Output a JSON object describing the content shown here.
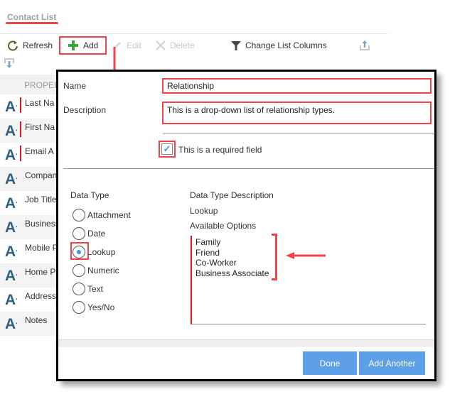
{
  "page": {
    "title": "Contact List"
  },
  "toolbar": {
    "refresh_label": "Refresh",
    "add_label": "Add",
    "edit_label": "Edit",
    "delete_label": "Delete",
    "change_columns_label": "Change List Columns",
    "icons": {
      "refresh": "refresh-icon",
      "add": "plus-icon",
      "edit": "pencil-icon",
      "delete": "x-icon",
      "change_columns": "filter-funnel-icon",
      "export": "upload-icon",
      "import": "download-icon"
    }
  },
  "list": {
    "header": "PROPER",
    "rows": [
      {
        "label": "Last Na",
        "required": true
      },
      {
        "label": "First Na",
        "required": true
      },
      {
        "label": "Email A",
        "required": true
      },
      {
        "label": "Compan",
        "required": false
      },
      {
        "label": "Job Title",
        "required": false
      },
      {
        "label": "Business",
        "required": false
      },
      {
        "label": "Mobile P",
        "required": false
      },
      {
        "label": "Home Pl",
        "required": false
      },
      {
        "label": "Address",
        "required": false
      },
      {
        "label": "Notes",
        "required": false
      }
    ],
    "row_icon": "text-type-A-icon"
  },
  "dialog": {
    "name_label": "Name",
    "name_value": "Relationship",
    "description_label": "Description",
    "description_value": "This is a drop-down list of relationship types.",
    "required_checked": true,
    "required_label": "This is a required field",
    "data_type_label": "Data Type",
    "data_types": [
      "Attachment",
      "Date",
      "Lookup",
      "Numeric",
      "Text",
      "Yes/No"
    ],
    "selected_data_type": "Lookup",
    "data_type_description_label": "Data Type Description",
    "data_type_description_value": "Lookup",
    "available_options_label": "Available Options",
    "available_options": [
      "Family",
      "Friend",
      "Co-Worker",
      "Business Associate"
    ],
    "done_label": "Done",
    "add_another_label": "Add Another"
  },
  "colors": {
    "annotation_red": "#f0444a",
    "required_red": "#e8141b",
    "button_blue": "#5da0e8",
    "icon_blue": "#2e6280",
    "add_green": "#3aa23a"
  }
}
